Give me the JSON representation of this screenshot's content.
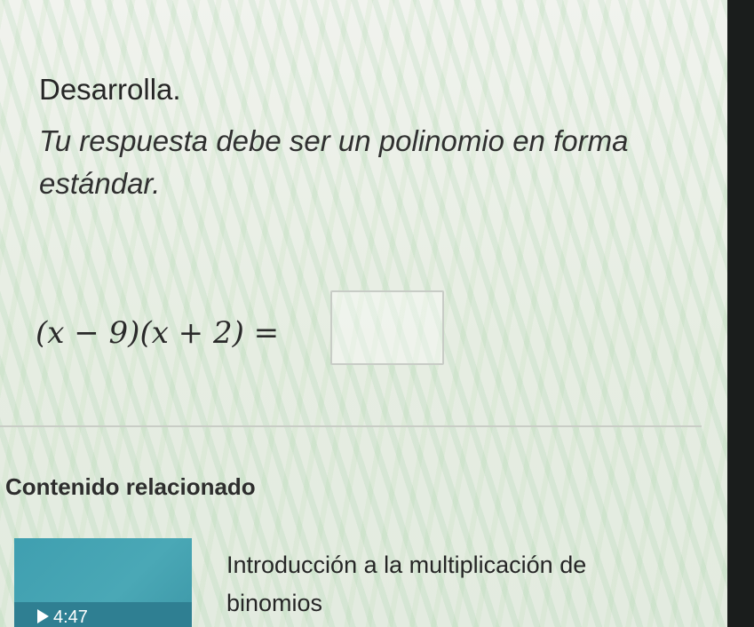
{
  "exercise": {
    "title": "Desarrolla.",
    "instruction": "Tu respuesta debe ser un polinomio en forma estándar.",
    "equation": "(x − 9)(x + 2) =",
    "answer_value": ""
  },
  "related": {
    "heading": "Contenido relacionado",
    "video": {
      "title": "Introducción a la multiplicación de binomios",
      "duration": "4:47",
      "thumb_color": "#4aa8b6"
    }
  }
}
